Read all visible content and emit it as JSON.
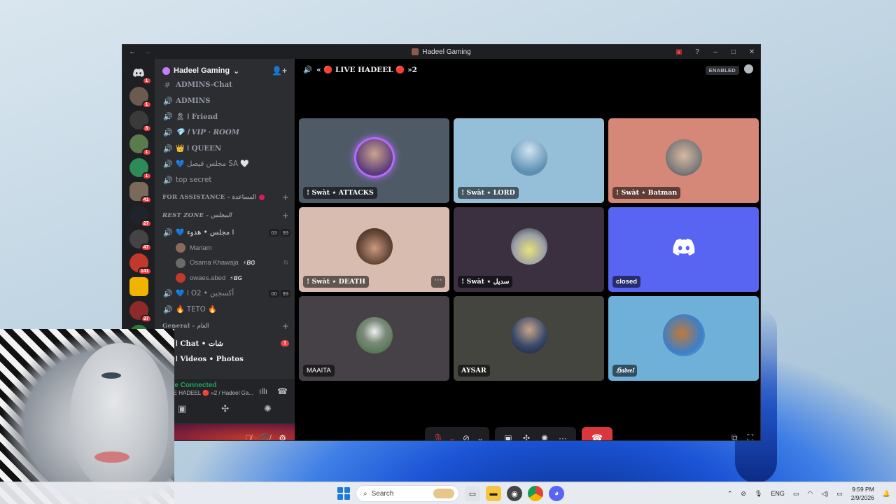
{
  "window": {
    "title": "Hadeel Gaming",
    "nav_back": "←",
    "nav_forward": "→"
  },
  "rail": {
    "servers": [
      {
        "badge": "1",
        "color": "#1e1f22"
      },
      {
        "badge": "1",
        "color": "#6b5a4e"
      },
      {
        "badge": "3",
        "color": "#3a3a3a"
      },
      {
        "badge": "1",
        "color": "#5b7a4e"
      },
      {
        "badge": "1",
        "color": "#2e8b57"
      },
      {
        "badge": "41",
        "color": "#7a6a5a"
      },
      {
        "badge": "27",
        "color": "#20242a"
      },
      {
        "badge": "47",
        "color": "#444"
      },
      {
        "badge": "141",
        "color": "#c0392b"
      },
      {
        "badge": "",
        "color": "#f0b400"
      },
      {
        "badge": "37",
        "color": "#8e2a2a"
      },
      {
        "badge": "86",
        "color": "#2e7d32"
      }
    ]
  },
  "sidebar": {
    "guild_name": "Hadeel Gaming",
    "channels_top": [
      {
        "icon": "#",
        "name": "ADMINS-Chat"
      },
      {
        "icon": "🔊",
        "name": "ADMINS"
      },
      {
        "icon": "🔊",
        "name": "🎗 ا Friend"
      },
      {
        "icon": "🔊",
        "name": "💎 ا VIP · ROOM"
      },
      {
        "icon": "🔊",
        "name": "👑 ا QUEEN"
      },
      {
        "icon": "🔊",
        "name": "💙 مجلس فيصل SA 🤍"
      },
      {
        "icon": "🔊",
        "name": "top secret"
      }
    ],
    "category_assist": "FOR ASSISTANCE - المساعدة",
    "category_rest": "REST ZONE - المجلس",
    "rest_channel": {
      "name": "💙 ا مجلس • هدوء",
      "count_a": "03",
      "count_b": "99"
    },
    "members": [
      {
        "name": "Mariam",
        "tag": ""
      },
      {
        "name": "Osama Khawaja",
        "tag": "⚡BG"
      },
      {
        "name": "owaes.abed",
        "tag": "⚡BG"
      }
    ],
    "o2_channel": {
      "name": "💙 ا O2 • أكسجين",
      "count_a": "00",
      "count_b": "99"
    },
    "teto_channel": "🔥 TETO 🔥",
    "category_general": "General - العام",
    "chat_channel": "ا Chat • شات",
    "chat_badge": "1",
    "videos_channel": "ا Videos • Photos",
    "voice_status": "Voice Connected",
    "voice_sub": "« LIVE HADEEL 🔴 »2 / Hadeel Ga..."
  },
  "stage": {
    "channel": "« 🔴 LIVE HADEEL 🔴 »2",
    "enabled_label": "ENABLED",
    "tiles": [
      {
        "label": "! Swàt ⋆ ATTACKS",
        "bg": "#4e5a66",
        "avatar": "#5a3a7a",
        "ring": true
      },
      {
        "label": "! Swàt ⋆ LORD",
        "bg": "#95bfd8",
        "avatar": "#5c8fb3",
        "ring": false
      },
      {
        "label": "! Swàt ⋆ Batman",
        "bg": "#d58878",
        "avatar": "#8a8a8a",
        "ring": false
      },
      {
        "label": "! Swàt ⋆ DEATH",
        "bg": "#d8bcb0",
        "avatar": "#4a3a34",
        "ring": false,
        "more": true
      },
      {
        "label": "! Swàt ⋆ سديل",
        "bg": "#3a3040",
        "avatar": "#cfd86a",
        "ring": false
      },
      {
        "label": "closed",
        "bg": "#5865f2",
        "discord": true
      },
      {
        "label": "MAAITA",
        "bg": "#464146",
        "avatar": "#3d6b3a",
        "ring": false
      },
      {
        "label": "AYSAR",
        "bg": "#454540",
        "avatar": "#2a3a5a",
        "ring": false
      },
      {
        "label": "ℌ𝔞𝔡𝔢𝔢𝔩",
        "bg": "#6fb0d8",
        "avatar": "#3d7fc7",
        "ring": false
      }
    ]
  },
  "taskbar": {
    "search_placeholder": "Search",
    "lang": "ENG",
    "time": "9:59 PM",
    "date": "2/9/2026"
  }
}
